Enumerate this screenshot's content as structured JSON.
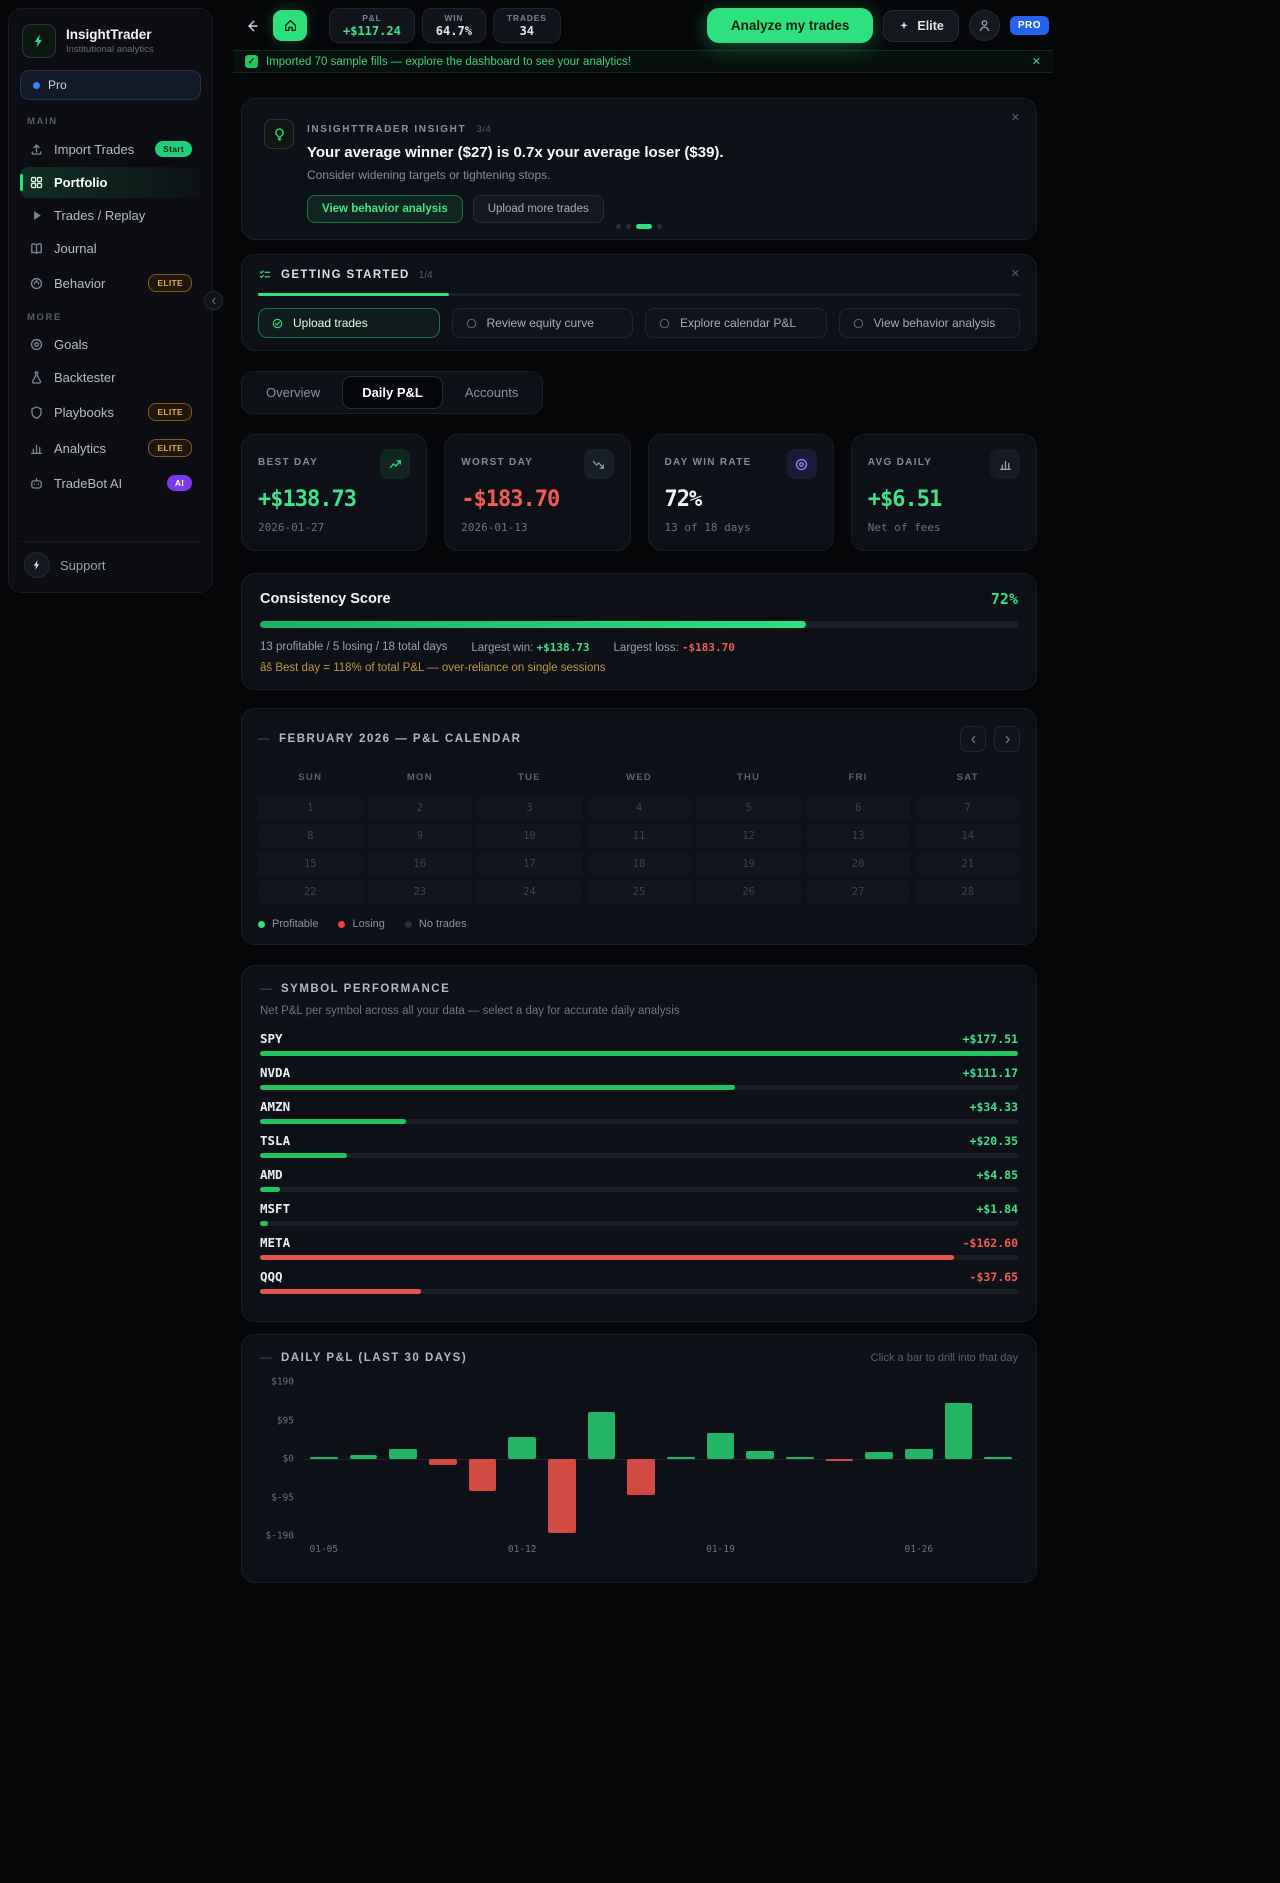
{
  "glyphs": {
    "close": "✕",
    "dash": "—",
    "check": "✓"
  },
  "sidebar": {
    "brand": {
      "name": "InsightTrader",
      "subtitle": "Institutional analytics"
    },
    "plan_pill": "Pro",
    "sections": [
      {
        "label": "MAIN",
        "items": [
          {
            "label": "Import Trades",
            "icon": "upload",
            "badge": "Start",
            "badge_style": "green",
            "active": false
          },
          {
            "label": "Portfolio",
            "icon": "grid",
            "active": true
          },
          {
            "label": "Trades / Replay",
            "icon": "play",
            "active": false
          },
          {
            "label": "Journal",
            "icon": "book",
            "active": false
          },
          {
            "label": "Behavior",
            "icon": "brain",
            "badge": "ELITE",
            "badge_style": "amber",
            "active": false
          }
        ]
      },
      {
        "label": "MORE",
        "items": [
          {
            "label": "Goals",
            "icon": "target",
            "active": false
          },
          {
            "label": "Backtester",
            "icon": "flask",
            "active": false
          },
          {
            "label": "Playbooks",
            "icon": "shield",
            "badge": "ELITE",
            "badge_style": "amber",
            "active": false
          },
          {
            "label": "Analytics",
            "icon": "bar-chart",
            "badge": "ELITE",
            "badge_style": "amber",
            "active": false
          },
          {
            "label": "TradeBot AI",
            "icon": "bot",
            "badge": "AI",
            "badge_style": "purple",
            "active": false
          }
        ]
      }
    ],
    "support_label": "Support"
  },
  "topbar": {
    "stats": [
      {
        "label": "P&L",
        "value": "+$117.24",
        "color": "#3fe38a"
      },
      {
        "label": "WIN",
        "value": "64.7%"
      },
      {
        "label": "TRADES",
        "value": "34"
      }
    ],
    "analyze_button": "Analyze my trades",
    "elite_button": "Elite",
    "pro_badge": "PRO"
  },
  "banner": {
    "text": "Imported 70 sample fills — explore the dashboard to see your analytics!"
  },
  "insight": {
    "kicker": "INSIGHTTRADER INSIGHT",
    "count": "3/4",
    "title": "Your average winner ($27) is 0.7x your average loser ($39).",
    "subtitle": "Consider widening targets or tightening stops.",
    "primary_button": "View behavior analysis",
    "secondary_button": "Upload more trades",
    "dots": {
      "count": 4,
      "active": 2
    }
  },
  "getting_started": {
    "title": "GETTING STARTED",
    "progress_label": "1/4",
    "progress_pct": 25,
    "steps": [
      {
        "label": "Upload trades",
        "done": true
      },
      {
        "label": "Review equity curve",
        "done": false
      },
      {
        "label": "Explore calendar P&L",
        "done": false
      },
      {
        "label": "View behavior analysis",
        "done": false
      }
    ]
  },
  "tabs": [
    {
      "label": "Overview",
      "active": false
    },
    {
      "label": "Daily P&L",
      "active": true
    },
    {
      "label": "Accounts",
      "active": false
    }
  ],
  "stat_cards": [
    {
      "label": "BEST DAY",
      "value": "+$138.73",
      "sub": "2026-01-27",
      "value_color": "#3fe38a",
      "icon": "trend-up",
      "icon_color": "#2ee07e",
      "icon_bg": "rgba(46,224,126,.1)"
    },
    {
      "label": "WORST DAY",
      "value": "-$183.70",
      "sub": "2026-01-13",
      "value_color": "#f25c52",
      "icon": "trend-down",
      "icon_color": "#7f9db8",
      "icon_bg": "rgba(100,130,160,.12)"
    },
    {
      "label": "DAY WIN RATE",
      "value": "72%",
      "sub": "13 of 18 days",
      "value_color": "#f3f4f6",
      "icon": "target",
      "icon_color": "#8f87f6",
      "icon_bg": "rgba(109,93,246,.15)"
    },
    {
      "label": "AVG DAILY",
      "value": "+$6.51",
      "sub": "Net of fees",
      "value_color": "#3fe38a",
      "icon": "bar-chart",
      "icon_color": "#9aa1ad",
      "icon_bg": "rgba(148,156,170,.08)"
    }
  ],
  "consistency": {
    "title": "Consistency Score",
    "percent": "72%",
    "progress_pct": 72,
    "stats_text": "13 profitable / 5 losing / 18 total days",
    "largest_win_label": "Largest win:",
    "largest_win": "+$138.73",
    "largest_loss_label": "Largest loss:",
    "largest_loss": "-$183.70",
    "warning": "âš Best day = 118% of total P&L — over-reliance on single sessions"
  },
  "calendar": {
    "title": "FEBRUARY 2026 — P&L CALENDAR",
    "weekdays": [
      "SUN",
      "MON",
      "TUE",
      "WED",
      "THU",
      "FRI",
      "SAT"
    ],
    "days": [
      1,
      2,
      3,
      4,
      5,
      6,
      7,
      8,
      9,
      10,
      11,
      12,
      13,
      14,
      15,
      16,
      17,
      18,
      19,
      20,
      21,
      22,
      23,
      24,
      25,
      26,
      27,
      28
    ],
    "legend": [
      {
        "label": "Profitable",
        "color": "#2ee07e"
      },
      {
        "label": "Losing",
        "color": "#ef4444"
      },
      {
        "label": "No trades",
        "color": "#2a2f39"
      }
    ]
  },
  "symbol_performance": {
    "title": "SYMBOL PERFORMANCE",
    "subtitle": "Net P&L per symbol across all your data — select a day for accurate daily analysis",
    "positive_color": "#22c55e",
    "negative_color": "#e25650",
    "rows": [
      {
        "symbol": "SPY",
        "value": "+$177.51",
        "pct": 100,
        "positive": true
      },
      {
        "symbol": "NVDA",
        "value": "+$111.17",
        "pct": 62.6,
        "positive": true
      },
      {
        "symbol": "AMZN",
        "value": "+$34.33",
        "pct": 19.3,
        "positive": true
      },
      {
        "symbol": "TSLA",
        "value": "+$20.35",
        "pct": 11.5,
        "positive": true
      },
      {
        "symbol": "AMD",
        "value": "+$4.85",
        "pct": 2.7,
        "positive": true
      },
      {
        "symbol": "MSFT",
        "value": "+$1.84",
        "pct": 1.0,
        "positive": true
      },
      {
        "symbol": "META",
        "value": "-$162.60",
        "pct": 91.6,
        "positive": false
      },
      {
        "symbol": "QQQ",
        "value": "-$37.65",
        "pct": 21.2,
        "positive": false
      }
    ]
  },
  "chart_data": {
    "type": "bar",
    "title": "DAILY P&L (LAST 30 DAYS)",
    "hint": "Click a bar to drill into that day",
    "x": [
      "01-05",
      "01-06",
      "01-07",
      "01-08",
      "01-09",
      "01-12",
      "01-13",
      "01-14",
      "01-15",
      "01-16",
      "01-19",
      "01-20",
      "01-21",
      "01-22",
      "01-23",
      "01-26",
      "01-27",
      "01-28"
    ],
    "values": [
      2,
      10,
      25,
      -14,
      -80,
      55,
      -183.7,
      115,
      -90,
      2,
      65,
      20,
      6,
      -4,
      18,
      25,
      138.73,
      4
    ],
    "ylim": [
      -190,
      190
    ],
    "yticks": [
      "$190",
      "$95",
      "$0",
      "$-95",
      "$-190"
    ],
    "xticks": [
      "01-05",
      "01-12",
      "01-19",
      "01-26"
    ],
    "xtick_indices": [
      0,
      5,
      10,
      15
    ],
    "grid": false,
    "legend_visible": false,
    "colors": {
      "positive": "#23b564",
      "negative": "#d24a44"
    }
  }
}
